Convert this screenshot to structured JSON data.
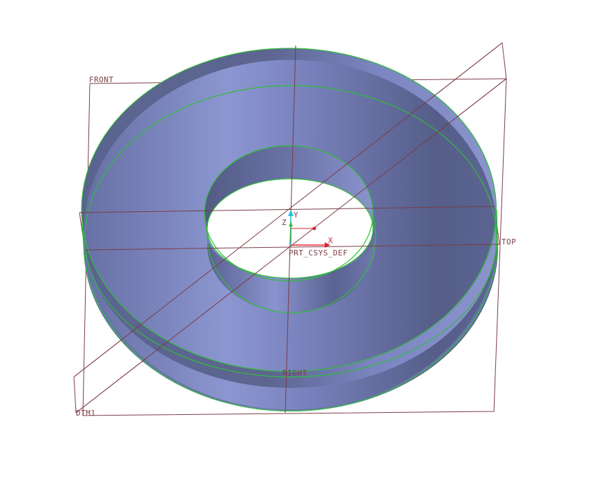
{
  "datum_planes": {
    "front": "FRONT",
    "top": "TOP",
    "right": "RIGHT",
    "dtm1": "DTM1"
  },
  "coordinate_system": {
    "name": "PRT_CSYS_DEF",
    "x_axis": "X",
    "y_axis": "Y",
    "z_axis": "Z"
  },
  "colors": {
    "datum": "#7a3c44",
    "edge_highlight": "#2fbf3a",
    "surface_dark": "#565e88",
    "surface_light": "#8a93cc",
    "x_axis": "#e0202a",
    "y_axis": "#22c0e0",
    "z_axis": "#3ab83a"
  }
}
